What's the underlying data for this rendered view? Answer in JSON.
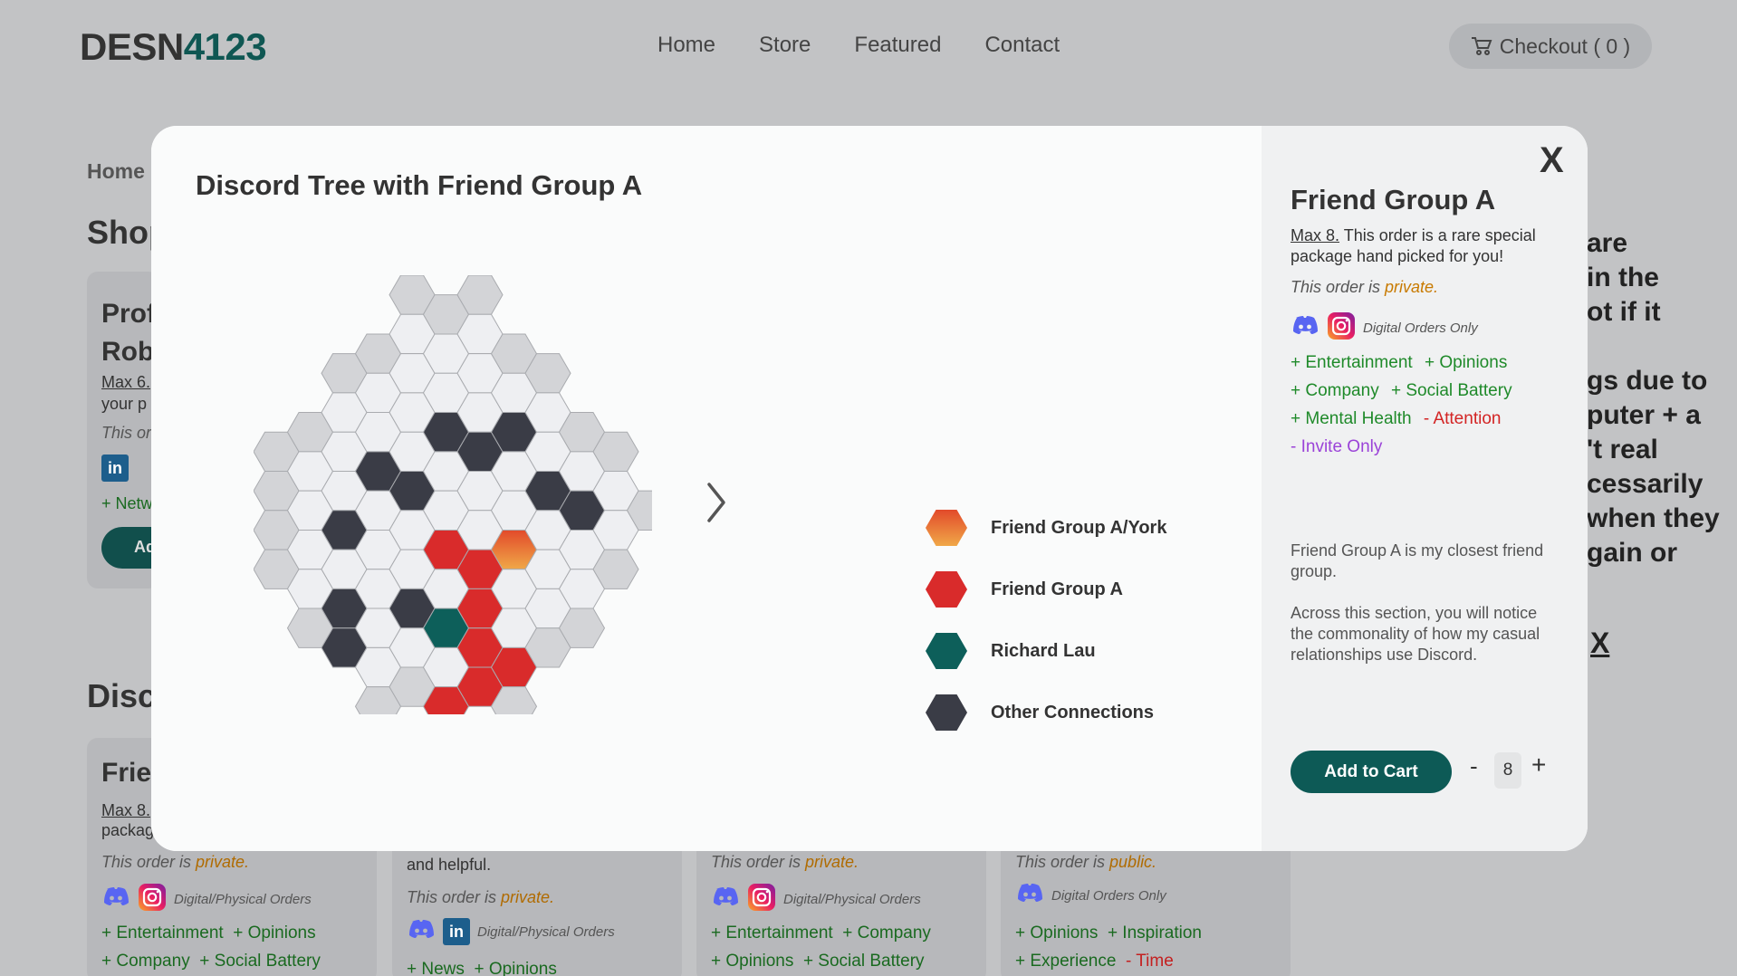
{
  "header": {
    "logo_text": "DESN",
    "logo_num": "4123",
    "nav": [
      "Home",
      "Store",
      "Featured",
      "Contact"
    ],
    "checkout": "Checkout ( 0 )"
  },
  "background": {
    "breadcrumb": "Home",
    "shop_heading": "Shop",
    "discord_heading": "Disc",
    "profile_card": {
      "title_l1": "Prof",
      "title_l2": "Rob",
      "max": "Max 6.",
      "desc": "your p",
      "privacy": "This or",
      "tag": "+ Netw",
      "btn": "Ad"
    },
    "right_text": [
      "are",
      "in the",
      "ot if it",
      "",
      "gs due to",
      "puter + a",
      "'t real",
      "cessarily",
      "when they",
      "gain or"
    ],
    "right_x": "X",
    "cards": [
      {
        "title": "Frie",
        "line1": "Max 8.",
        "line2": "packag",
        "priv_prefix": "This order is ",
        "priv_word": "private.",
        "icons_label": "Digital/Physical Orders",
        "tags": [
          [
            "+ Entertainment",
            "+ Opinions"
          ],
          [
            "+ Company",
            "+ Social Battery"
          ]
        ]
      },
      {
        "title": "",
        "line1": "and helpful.",
        "line2": "",
        "priv_prefix": "This order is ",
        "priv_word": "private.",
        "icons_label": "Digital/Physical Orders",
        "tags": [
          [
            "+ News",
            "+ Opinions"
          ]
        ]
      },
      {
        "title": "",
        "line1": "",
        "line2": "",
        "priv_prefix": "This order is ",
        "priv_word": "private.",
        "icons_label": "Digital/Physical Orders",
        "tags": [
          [
            "+ Entertainment",
            "+ Company"
          ],
          [
            "+ Opinions",
            "+ Social Battery"
          ]
        ]
      },
      {
        "title": "",
        "line1": "",
        "line2": "",
        "priv_prefix": "This order is ",
        "priv_word": "public.",
        "icons_label": "Digital Orders Only",
        "tags": [
          [
            "+ Opinions",
            "+ Inspiration"
          ],
          [
            "+ Experience",
            "- Time"
          ]
        ]
      }
    ]
  },
  "modal": {
    "title": "Discord Tree with Friend Group A",
    "legend": [
      {
        "label": "Friend Group A/York",
        "color": "gradient"
      },
      {
        "label": "Friend Group A",
        "color": "#d92b2b"
      },
      {
        "label": "Richard Lau",
        "color": "#0d5f5a"
      },
      {
        "label": "Other Connections",
        "color": "#3a3c46"
      }
    ],
    "panel": {
      "title": "Friend Group A",
      "max": "Max 8.",
      "desc": " This order is a rare special package hand picked for you!",
      "priv_prefix": "This order is ",
      "priv_word": "private.",
      "icons_label": "Digital Orders Only",
      "tag_rows": [
        [
          {
            "text": "+ Entertainment",
            "kind": "pos"
          },
          {
            "text": "+ Opinions",
            "kind": "pos"
          }
        ],
        [
          {
            "text": "+ Company",
            "kind": "pos"
          },
          {
            "text": "+ Social Battery",
            "kind": "pos"
          }
        ],
        [
          {
            "text": "+ Mental Health",
            "kind": "pos"
          },
          {
            "text": "- Attention",
            "kind": "neg"
          }
        ],
        [
          {
            "text": "- Invite Only",
            "kind": "pur"
          }
        ]
      ],
      "body1": "Friend Group A is my closest friend group.",
      "body2": "Across this section, you will notice the commonality of how my casual relationships use Discord.",
      "add_to_cart": "Add to Cart",
      "qty_minus": "-",
      "qty": "8",
      "qty_plus": "+",
      "close": "X"
    },
    "colors": {
      "red": "#d92b2b",
      "teal": "#0d5f5a",
      "dark": "#3a3c46",
      "light": "#eeeff2",
      "grey": "#d3d4d7",
      "accent": "#0d5a56"
    }
  }
}
